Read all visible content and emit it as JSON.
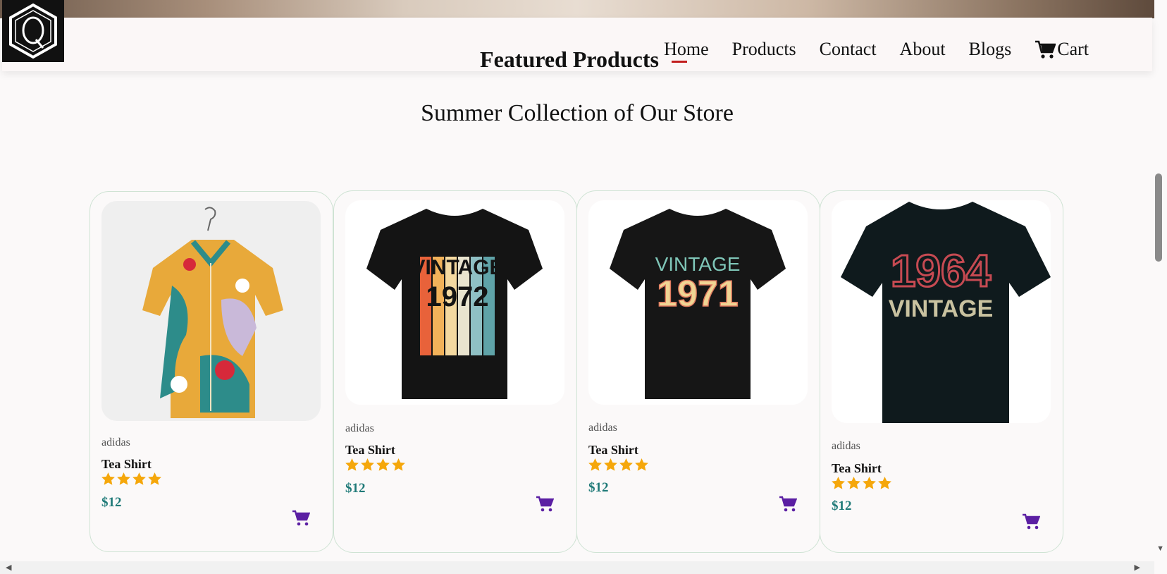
{
  "nav": {
    "items": [
      "Home",
      "Products",
      "Contact",
      "About",
      "Blogs"
    ],
    "cart_label": "Cart"
  },
  "featured_title": "Featured Products",
  "subtitle": "Summer Collection of Our Store",
  "products": [
    {
      "brand": "adidas",
      "name": "Tea Shirt",
      "rating": 4,
      "price": "$12",
      "image": "floral-shirt"
    },
    {
      "brand": "adidas",
      "name": "Tea Shirt",
      "rating": 4,
      "price": "$12",
      "image": "vintage-1972-tee",
      "graphic_top": "VINTAGE",
      "graphic_year": "1972"
    },
    {
      "brand": "adidas",
      "name": "Tea Shirt",
      "rating": 4,
      "price": "$12",
      "image": "vintage-1971-tee",
      "graphic_top": "VINTAGE",
      "graphic_year": "1971"
    },
    {
      "brand": "adidas",
      "name": "Tea Shirt",
      "rating": 4,
      "price": "$12",
      "image": "vintage-1964-tee",
      "graphic_top": "1964",
      "graphic_year": "VINTAGE"
    }
  ],
  "colors": {
    "price": "#1f7a78",
    "star": "#f5a70b",
    "cart_icon": "#5b1fa3",
    "accent_dash": "#c21d1d"
  }
}
